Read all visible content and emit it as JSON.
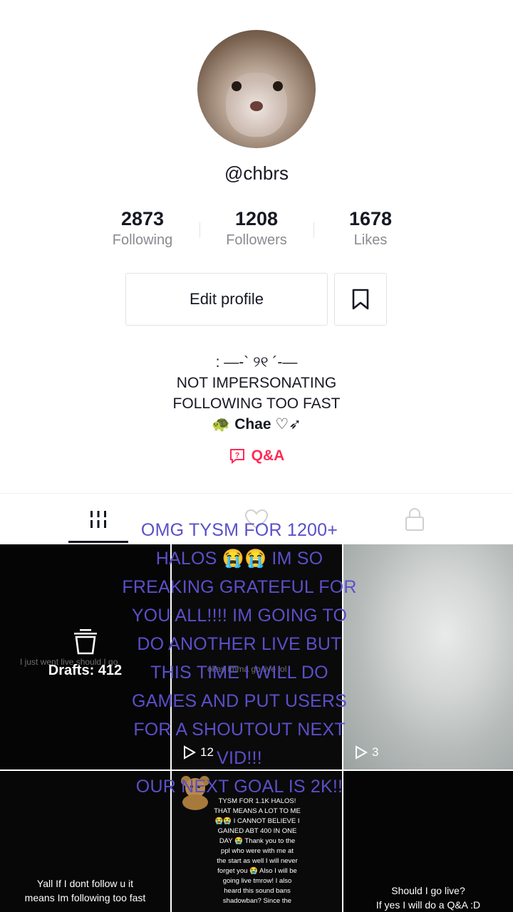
{
  "profile": {
    "username": "@chbrs",
    "stats": [
      {
        "value": "2873",
        "label": "Following"
      },
      {
        "value": "1208",
        "label": "Followers"
      },
      {
        "value": "1678",
        "label": "Likes"
      }
    ],
    "edit_profile_label": "Edit profile",
    "bio_lines": [
      ": ―-` ୨୧ ´-―",
      "NOT IMPERSONATING",
      "FOLLOWING TOO FAST"
    ],
    "bio_name_prefix": "🐢",
    "bio_name": "Chae",
    "bio_name_suffix": "♡➶",
    "qa_label": "Q&A"
  },
  "tabs": [
    {
      "icon": "grid-icon",
      "active": true
    },
    {
      "icon": "liked-heart-icon",
      "active": false
    },
    {
      "icon": "lock-icon",
      "active": false
    }
  ],
  "grid": {
    "drafts_label": "Drafts: 412",
    "cell1_faint_text": "I just went live should I go",
    "cell2_faint_text": "okay imma go live lol",
    "cell2_plays": "12",
    "cell3_plays": "3",
    "cell4_text": [
      "Yall If I dont follow u it",
      "means Im following too fast"
    ],
    "cell5_text": [
      "TYSM FOR 1.1K HALOS!",
      "THAT MEANS A LOT TO ME",
      "😭😭 I CANNOT BELIEVE I",
      "GAINED ABT 400 IN ONE",
      "DAY 😭 Thank you to the",
      "ppl who were with me at",
      "the start as well I will never",
      "forget you 😭 Also I will be",
      "going live tmrow! I also",
      "heard this sound bans",
      "shadowban? Since the"
    ],
    "cell6_text": [
      "Should I go live?",
      "If yes I will do a Q&A :D"
    ]
  },
  "overlay": {
    "lines": [
      "OMG TYSM FOR 1200+",
      "HALOS 😭😭 IM SO",
      "FREAKING GRATEFUL FOR",
      "YOU ALL!!!! IM GOING TO",
      "DO ANOTHER LIVE BUT",
      "THIS TIME I WILL DO",
      "GAMES AND PUT USERS",
      "FOR A SHOUTOUT NEXT",
      "VID!!!",
      "OUR NEXT GOAL IS 2K!!"
    ],
    "color": "#5b4fc9"
  },
  "colors": {
    "accent": "#fe2c55",
    "text": "#161823",
    "muted": "#8a8b91"
  }
}
